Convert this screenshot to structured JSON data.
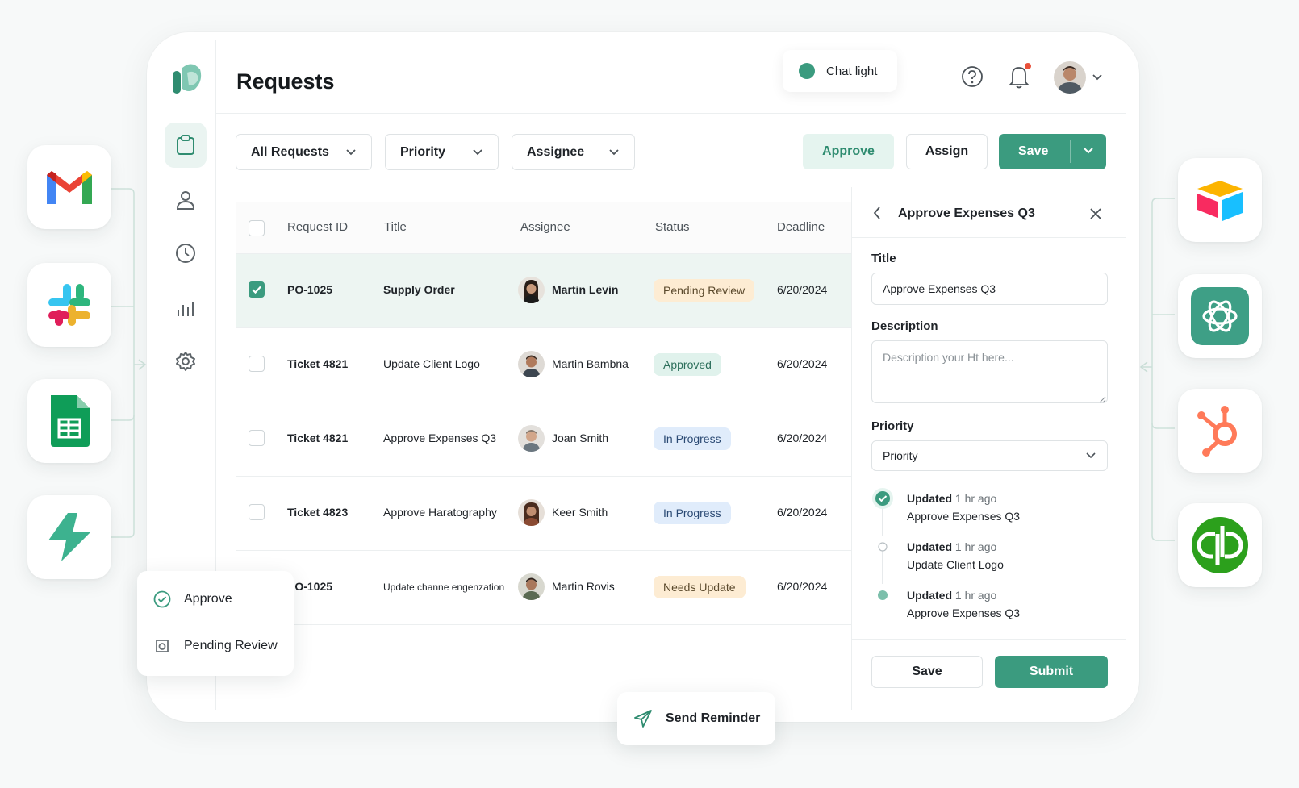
{
  "page": {
    "title": "Requests"
  },
  "chat": {
    "label": "Chat light"
  },
  "filters": {
    "all_requests": "All Requests",
    "priority": "Priority",
    "assignee": "Assignee"
  },
  "actions": {
    "approve": "Approve",
    "assign": "Assign",
    "save": "Save"
  },
  "table": {
    "headers": [
      "Request ID",
      "Title",
      "Assignee",
      "Status",
      "Deadline"
    ],
    "rows": [
      {
        "id": "PO-1025",
        "title": "Supply Order",
        "assignee": "Martin Levin",
        "status": "Pending Review",
        "deadline": "6/20/2024"
      },
      {
        "id": "Ticket 4821",
        "title": "Update Client Logo",
        "assignee": "Martin Bambna",
        "status": "Approved",
        "deadline": "6/20/2024"
      },
      {
        "id": "Ticket 4821",
        "title": "Approve Expenses Q3",
        "assignee": "Joan Smith",
        "status": "In Progress",
        "deadline": "6/20/2024"
      },
      {
        "id": "Ticket 4823",
        "title": "Approve Haratography",
        "assignee": "Keer Smith",
        "status": "In Progress",
        "deadline": "6/20/2024"
      },
      {
        "id": "PO-1025",
        "title": "Update channe engenzation",
        "assignee": "Martin Rovis",
        "status": "Needs Update",
        "deadline": "6/20/2024"
      }
    ]
  },
  "panel": {
    "title": "Approve Expenses Q3",
    "title_label": "Title",
    "title_value": "Approve Expenses Q3",
    "description_label": "Description",
    "description_placeholder": "Description your Ht here...",
    "priority_label": "Priority",
    "priority_value": "Priority",
    "timeline": [
      {
        "action": "Updated",
        "time": "1 hr ago",
        "item": "Approve Expenses Q3"
      },
      {
        "action": "Updated",
        "time": "1 hr ago",
        "item": "Update Client Logo"
      },
      {
        "action": "Updated",
        "time": "1 hr ago",
        "item": "Approve Expenses Q3"
      }
    ],
    "save": "Save",
    "submit": "Submit"
  },
  "status_menu": {
    "approve": "Approve",
    "pending": "Pending Review"
  },
  "reminder": {
    "label": "Send Reminder"
  },
  "colors": {
    "accent": "#3b9b7f",
    "accent_light": "#e5f4ef",
    "notification": "#e8503a"
  },
  "integrations_left": [
    "gmail-icon",
    "slack-icon",
    "google-sheets-icon",
    "zapier-bolt-icon"
  ],
  "integrations_right": [
    "airtable-icon",
    "openai-icon",
    "hubspot-icon",
    "quickbooks-icon"
  ]
}
